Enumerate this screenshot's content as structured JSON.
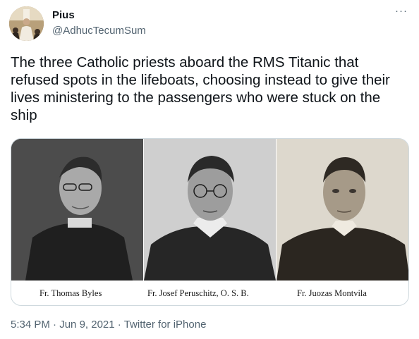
{
  "user": {
    "display_name": "Pius",
    "handle": "@AdhucTecumSum"
  },
  "more_icon": "···",
  "tweet": {
    "text": "The three Catholic priests aboard the RMS Titanic that refused spots in the lifeboats, choosing instead to give their lives ministering to the passengers who were stuck on the ship"
  },
  "media": {
    "captions": [
      "Fr. Thomas Byles",
      "Fr. Josef Peruschitz, O. S. B.",
      "Fr. Juozas Montvila"
    ]
  },
  "footer": {
    "time": "5:34 PM",
    "separator": " · ",
    "date": "Jun 9, 2021",
    "source": "Twitter for iPhone"
  },
  "colors": {
    "text": "#0f1419",
    "secondary": "#536471",
    "border": "#cfd9de"
  }
}
